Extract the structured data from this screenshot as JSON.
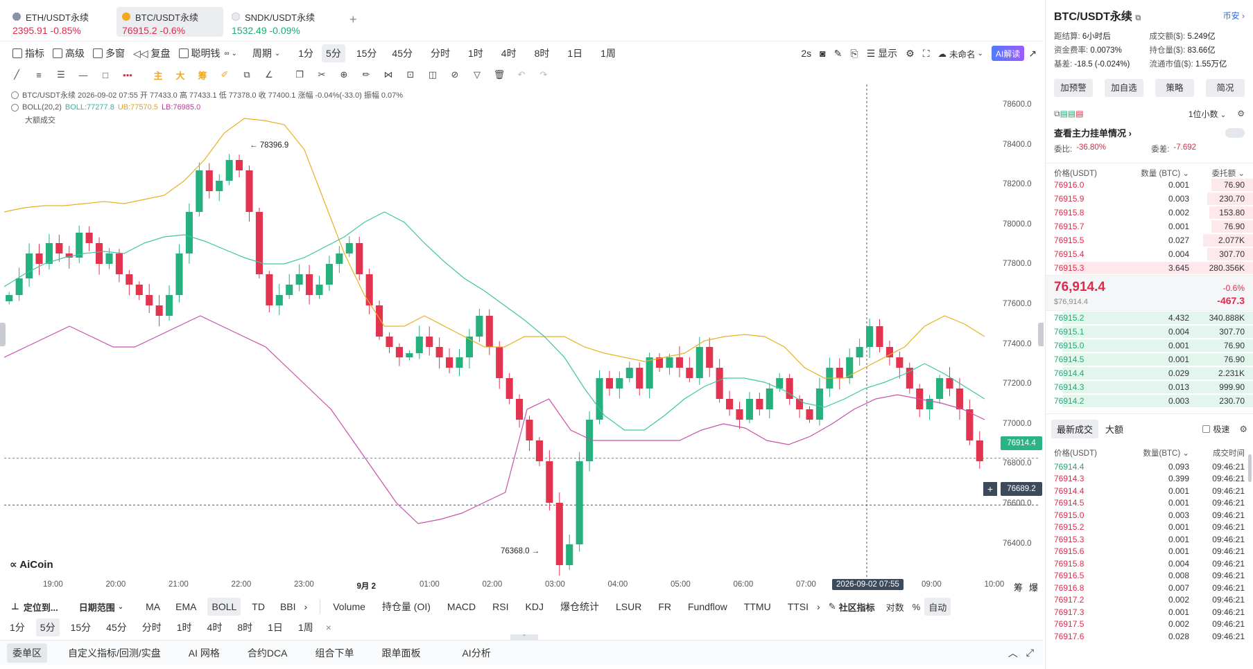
{
  "tabs": [
    {
      "name": "ETH/USDT永续",
      "price": "2395.91",
      "chg": "-0.85%",
      "dir": "down",
      "coin": "#8a93a6"
    },
    {
      "name": "BTC/USDT永续",
      "price": "76915.2",
      "chg": "-0.6%",
      "dir": "down",
      "coin": "#f1a924"
    },
    {
      "name": "SNDK/USDT永续",
      "price": "1532.49",
      "chg": "-0.09%",
      "dir": "up",
      "coin": "#e7ecf2"
    }
  ],
  "toolbar": {
    "indicators": "指标",
    "advanced": "高级",
    "multiwin": "多窗",
    "replay": "复盘",
    "smart": "聪明钱",
    "period": "周期",
    "periods": [
      "1分",
      "5分",
      "15分",
      "45分",
      "分时",
      "1时",
      "4时",
      "8时",
      "1日",
      "1周"
    ],
    "refresh": "2s",
    "display": "显示",
    "unnamed": "未命名",
    "ai": "AI解读"
  },
  "drawtools": {
    "main": "主",
    "big": "大",
    "chip": "筹"
  },
  "chartinfo": {
    "line1": "BTC/USDT永续  2026-09-02 07:55  开 77433.0 高 77433.1 低 77378.0 收 77400.1 涨幅 -0.04%(-33.0) 振幅 0.07%",
    "boll": "BOLL(20,2)",
    "boll_mid": "BOLL:77277.8",
    "boll_ub": "UB:77570.5",
    "boll_lb": "LB:76985.0",
    "bigvol": "大额成交"
  },
  "yaxis": [
    "78600.0",
    "78400.0",
    "78200.0",
    "78000.0",
    "77800.0",
    "77600.0",
    "77400.0",
    "77200.0",
    "77000.0",
    "76800.0",
    "76600.0",
    "76400.0"
  ],
  "xaxis": [
    "19:00",
    "20:00",
    "21:00",
    "22:00",
    "23:00",
    "9月 2",
    "01:00",
    "02:00",
    "03:00",
    "04:00",
    "05:00",
    "06:00",
    "07:00",
    "08:00",
    "09:00",
    "10:00"
  ],
  "crosshair_time": "2026-09-02 07:55",
  "price_chip": "76914.4",
  "cross_chip": "76689.2",
  "high_mark": "← 78396.9",
  "low_mark": "76368.0 →",
  "brand": "AiCoin",
  "axis_tags": {
    "a": "筹",
    "b": "爆"
  },
  "chart_data": {
    "type": "candlestick",
    "title": "BTC/USDT永续 5分",
    "y_range": [
      76300,
      78700
    ],
    "x_range": [
      "2026-09-01 18:30",
      "2026-09-02 10:00"
    ],
    "close_path": [
      77700,
      77780,
      77900,
      77850,
      77950,
      77900,
      77880,
      78000,
      77950,
      77850,
      77900,
      77800,
      77750,
      77700,
      77650,
      77600,
      77700,
      77900,
      78100,
      78300,
      78200,
      78250,
      78350,
      78300,
      78100,
      77800,
      77650,
      77700,
      77750,
      77800,
      77700,
      77750,
      77850,
      77900,
      77950,
      77800,
      77650,
      77500,
      77450,
      77400,
      77420,
      77500,
      77450,
      77400,
      77350,
      77400,
      77500,
      77600,
      77450,
      77300,
      77200,
      77100,
      77000,
      76900,
      76700,
      76400,
      76500,
      76900,
      77100,
      77300,
      77250,
      77300,
      77350,
      77250,
      77400,
      77350,
      77400,
      77350,
      77300,
      77450,
      77350,
      77200,
      77150,
      77100,
      77200,
      77150,
      77250,
      77300,
      77200,
      77150,
      77100,
      77250,
      77350,
      77300,
      77400,
      77450,
      77550,
      77450,
      77400,
      77350,
      77250,
      77150,
      77200,
      77300,
      77250,
      77150,
      77000,
      76900
    ],
    "boll_mid": [
      77740,
      77800,
      77850,
      77880,
      77900,
      77910,
      77900,
      77950,
      77980,
      77990,
      77960,
      77920,
      77880,
      77850,
      77850,
      77880,
      77930,
      77980,
      78050,
      78100,
      78050,
      77950,
      77860,
      77780,
      77720,
      77650,
      77580,
      77500,
      77400,
      77250,
      77120,
      77050,
      77050,
      77120,
      77200,
      77260,
      77300,
      77300,
      77280,
      77240,
      77180,
      77160,
      77200,
      77250,
      77280,
      77320,
      77370,
      77320,
      77260,
      77200
    ],
    "boll_ub": [
      78100,
      78120,
      78130,
      78130,
      78140,
      78150,
      78140,
      78160,
      78180,
      78250,
      78350,
      78480,
      78550,
      78540,
      78520,
      78400,
      78150,
      77900,
      77700,
      77550,
      77550,
      77600,
      77550,
      77500,
      77450,
      77450,
      77500,
      77500,
      77500,
      77450,
      77420,
      77400,
      77380,
      77400,
      77420,
      77480,
      77500,
      77510,
      77500,
      77450,
      77350,
      77300,
      77300,
      77350,
      77400,
      77450,
      77550,
      77600,
      77560,
      77500
    ],
    "boll_lb": [
      77400,
      77450,
      77500,
      77550,
      77500,
      77450,
      77450,
      77500,
      77550,
      77600,
      77550,
      77500,
      77450,
      77350,
      77250,
      77150,
      77000,
      76850,
      76700,
      76600,
      76620,
      76650,
      76700,
      76750,
      77150,
      77200,
      77050,
      77000,
      77000,
      77000,
      77000,
      77000,
      77050,
      77080,
      77060,
      77000,
      76980,
      77020,
      77080,
      77150,
      77200,
      77220,
      77200,
      77180,
      77150,
      77100
    ]
  },
  "bottombar": {
    "locate": "定位到...",
    "daterange": "日期范围",
    "mains": [
      "MA",
      "EMA",
      "BOLL",
      "TD",
      "BBI"
    ],
    "subs": [
      "Volume",
      "持仓量 (OI)",
      "MACD",
      "RSI",
      "KDJ",
      "爆仓统计",
      "LSUR",
      "FR",
      "Fundflow",
      "TTMU",
      "TTSI"
    ],
    "community": "社区指标",
    "log": "对数",
    "pct": "%",
    "auto": "自动"
  },
  "bottom_periods": [
    "1分",
    "5分",
    "15分",
    "45分",
    "分时",
    "1时",
    "4时",
    "8时",
    "1日",
    "1周"
  ],
  "bottom_tabs": [
    "委单区",
    "自定义指标/回测/实盘",
    "AI 网格",
    "合约DCA",
    "组合下单",
    "跟单面板",
    "AI分析"
  ],
  "right": {
    "title": "BTC/USDT永续",
    "coin_link": "币安",
    "stats": [
      {
        "k": "距结算:",
        "v": "6小时后"
      },
      {
        "k": "成交额($):",
        "v": "5.249亿"
      },
      {
        "k": "资金费率:",
        "v": "0.0073%",
        "c": "green"
      },
      {
        "k": "持仓量($):",
        "v": "83.66亿"
      },
      {
        "k": "基差:",
        "v": "-18.5 (-0.024%)",
        "c": "red"
      },
      {
        "k": "流通市值($):",
        "v": "1.55万亿"
      }
    ],
    "buttons": [
      "加预警",
      "加自选",
      "策略",
      "简况"
    ],
    "decimals": "1位小数",
    "mainorders": "查看主力挂单情况",
    "ratio_label": "委比:",
    "ratio": "-36.80%",
    "diff_label": "委差:",
    "diff": "-7.692",
    "book_headers": [
      "价格(USDT)",
      "数量 (BTC)",
      "委托额"
    ],
    "asks": [
      {
        "p": "76916.0",
        "q": "0.001",
        "t": "76.90",
        "w": 0.2
      },
      {
        "p": "76915.9",
        "q": "0.003",
        "t": "230.70",
        "w": 0.22
      },
      {
        "p": "76915.8",
        "q": "0.002",
        "t": "153.80",
        "w": 0.21
      },
      {
        "p": "76915.7",
        "q": "0.001",
        "t": "76.90",
        "w": 0.2
      },
      {
        "p": "76915.5",
        "q": "0.027",
        "t": "2.077K",
        "w": 0.24
      },
      {
        "p": "76915.4",
        "q": "0.004",
        "t": "307.70",
        "w": 0.22
      },
      {
        "p": "76915.3",
        "q": "3.645",
        "t": "280.356K",
        "w": 0.92
      }
    ],
    "last_price": "76,914.4",
    "last_usd": "$76,914.4",
    "last_pct": "-0.6%",
    "last_chg": "-467.3",
    "bids": [
      {
        "p": "76915.2",
        "q": "4.432",
        "t": "340.888K",
        "w": 0.92
      },
      {
        "p": "76915.1",
        "q": "0.004",
        "t": "307.70",
        "w": 0.92
      },
      {
        "p": "76915.0",
        "q": "0.001",
        "t": "76.90",
        "w": 0.92
      },
      {
        "p": "76914.5",
        "q": "0.001",
        "t": "76.90",
        "w": 0.92
      },
      {
        "p": "76914.4",
        "q": "0.029",
        "t": "2.231K",
        "w": 0.92
      },
      {
        "p": "76914.3",
        "q": "0.013",
        "t": "999.90",
        "w": 0.92
      },
      {
        "p": "76914.2",
        "q": "0.003",
        "t": "230.70",
        "w": 0.92
      }
    ],
    "trade_tabs": [
      "最新成交",
      "大额"
    ],
    "speed": "极速",
    "trade_headers": [
      "价格(USDT)",
      "数量(BTC)",
      "成交时间"
    ],
    "trades": [
      {
        "p": "76914.4",
        "q": "0.093",
        "t": "09:46:21",
        "c": "green"
      },
      {
        "p": "76914.3",
        "q": "0.399",
        "t": "09:46:21",
        "c": "red"
      },
      {
        "p": "76914.4",
        "q": "0.001",
        "t": "09:46:21",
        "c": "red"
      },
      {
        "p": "76914.5",
        "q": "0.001",
        "t": "09:46:21",
        "c": "red"
      },
      {
        "p": "76915.0",
        "q": "0.003",
        "t": "09:46:21",
        "c": "red"
      },
      {
        "p": "76915.2",
        "q": "0.001",
        "t": "09:46:21",
        "c": "red"
      },
      {
        "p": "76915.3",
        "q": "0.001",
        "t": "09:46:21",
        "c": "red"
      },
      {
        "p": "76915.6",
        "q": "0.001",
        "t": "09:46:21",
        "c": "red"
      },
      {
        "p": "76915.8",
        "q": "0.004",
        "t": "09:46:21",
        "c": "red"
      },
      {
        "p": "76916.5",
        "q": "0.008",
        "t": "09:46:21",
        "c": "red"
      },
      {
        "p": "76916.8",
        "q": "0.007",
        "t": "09:46:21",
        "c": "red"
      },
      {
        "p": "76917.2",
        "q": "0.002",
        "t": "09:46:21",
        "c": "red"
      },
      {
        "p": "76917.3",
        "q": "0.001",
        "t": "09:46:21",
        "c": "red"
      },
      {
        "p": "76917.5",
        "q": "0.002",
        "t": "09:46:21",
        "c": "red"
      },
      {
        "p": "76917.6",
        "q": "0.028",
        "t": "09:46:21",
        "c": "red"
      }
    ]
  }
}
